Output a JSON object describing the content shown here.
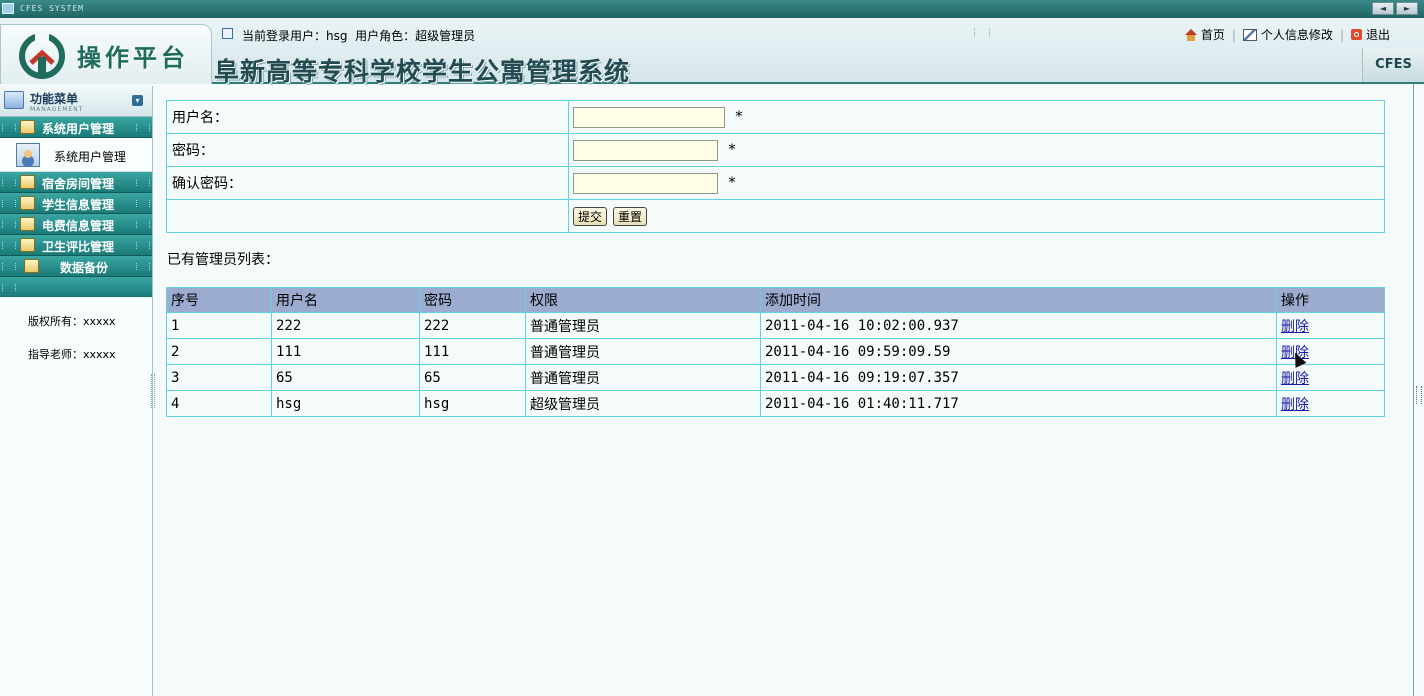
{
  "window": {
    "title": "CFES SYSTEM"
  },
  "header": {
    "logo_text": "操作平台",
    "system_title": "阜新高等专科学校学生公寓管理系统",
    "user_info": "当前登录用户：hsg  用户角色：超级管理员",
    "links": {
      "home": "首页",
      "profile": "个人信息修改",
      "logout": "退出"
    },
    "badge": "CFES"
  },
  "sidebar": {
    "menu_title": "功能菜单",
    "menu_subtitle": "MANAGEMENT",
    "groups": [
      {
        "label": "系统用户管理"
      },
      {
        "label": "宿舍房间管理"
      },
      {
        "label": "学生信息管理"
      },
      {
        "label": "电费信息管理"
      },
      {
        "label": "卫生评比管理"
      },
      {
        "label": "数据备份"
      }
    ],
    "submenu": [
      {
        "label": "系统用户管理"
      }
    ],
    "copyright": "版权所有：xxxxx",
    "advisor": "指导老师：xxxxx"
  },
  "form": {
    "username_label": "用户名：",
    "password_label": "密码：",
    "confirm_label": "确认密码：",
    "required_mark": "*",
    "username_value": "",
    "password_value": "",
    "confirm_value": "",
    "submit_label": "提交",
    "reset_label": "重置"
  },
  "list": {
    "title": "已有管理员列表：",
    "headers": [
      "序号",
      "用户名",
      "密码",
      "权限",
      "添加时间",
      "操作"
    ],
    "rows": [
      {
        "id": "1",
        "username": "222",
        "password": "222",
        "role": "普通管理员",
        "time": "2011-04-16 10:02:00.937",
        "action": "删除"
      },
      {
        "id": "2",
        "username": "111",
        "password": "111",
        "role": "普通管理员",
        "time": "2011-04-16 09:59:09.59",
        "action": "删除"
      },
      {
        "id": "3",
        "username": "65",
        "password": "65",
        "role": "普通管理员",
        "time": "2011-04-16 09:19:07.357",
        "action": "删除"
      },
      {
        "id": "4",
        "username": "hsg",
        "password": "hsg",
        "role": "超级管理员",
        "time": "2011-04-16 01:40:11.717",
        "action": "删除"
      }
    ]
  }
}
